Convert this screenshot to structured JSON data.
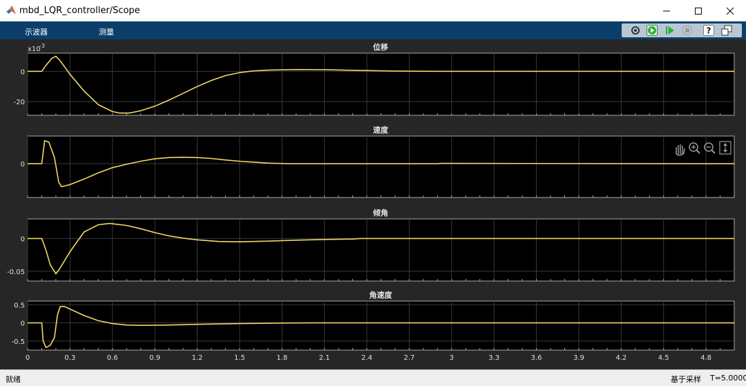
{
  "window": {
    "title": "mbd_LQR_controller/Scope",
    "minimize_icon": "minimize-icon",
    "maximize_icon": "maximize-icon",
    "close_icon": "close-icon"
  },
  "toolbar": {
    "tabs": [
      "示波器",
      "测量"
    ],
    "buttons": [
      "settings-icon",
      "run-icon",
      "step-forward-icon",
      "stop-icon",
      "help-icon",
      "undock-icon"
    ],
    "colors": {
      "background": "#0b3e6b",
      "run": "#29b23a"
    }
  },
  "plots": [
    {
      "title": "位移",
      "exponent_base": "x10",
      "exponent_power": "-3",
      "ylim": [
        -0.029,
        0.012
      ],
      "yticks": [
        {
          "value": 0,
          "label": "0"
        },
        {
          "value": -0.02,
          "label": "-20"
        }
      ],
      "points": [
        [
          0,
          0
        ],
        [
          0.1,
          0
        ],
        [
          0.13,
          0.004
        ],
        [
          0.17,
          0.0085
        ],
        [
          0.2,
          0.01
        ],
        [
          0.23,
          0.007
        ],
        [
          0.3,
          -0.002
        ],
        [
          0.4,
          -0.013
        ],
        [
          0.5,
          -0.022
        ],
        [
          0.6,
          -0.0265
        ],
        [
          0.65,
          -0.0275
        ],
        [
          0.72,
          -0.0275
        ],
        [
          0.8,
          -0.026
        ],
        [
          0.9,
          -0.023
        ],
        [
          1.0,
          -0.019
        ],
        [
          1.1,
          -0.0145
        ],
        [
          1.2,
          -0.01
        ],
        [
          1.3,
          -0.006
        ],
        [
          1.4,
          -0.0028
        ],
        [
          1.5,
          -0.0008
        ],
        [
          1.6,
          0.0003
        ],
        [
          1.7,
          0.0008
        ],
        [
          1.9,
          0.0012
        ],
        [
          2.1,
          0.0011
        ],
        [
          2.3,
          0.0007
        ],
        [
          2.6,
          0.0002
        ],
        [
          2.9,
          0
        ],
        [
          5,
          0
        ]
      ]
    },
    {
      "title": "速度",
      "ylim": [
        -0.11,
        0.09
      ],
      "yticks": [
        {
          "value": 0,
          "label": "0"
        }
      ],
      "points": [
        [
          0,
          0
        ],
        [
          0.1,
          0
        ],
        [
          0.12,
          0.075
        ],
        [
          0.15,
          0.07
        ],
        [
          0.19,
          0.02
        ],
        [
          0.22,
          -0.06
        ],
        [
          0.24,
          -0.075
        ],
        [
          0.3,
          -0.068
        ],
        [
          0.4,
          -0.05
        ],
        [
          0.5,
          -0.03
        ],
        [
          0.6,
          -0.013
        ],
        [
          0.7,
          -0.002
        ],
        [
          0.8,
          0.008
        ],
        [
          0.9,
          0.016
        ],
        [
          1.0,
          0.02
        ],
        [
          1.1,
          0.021
        ],
        [
          1.2,
          0.02
        ],
        [
          1.3,
          0.017
        ],
        [
          1.4,
          0.012
        ],
        [
          1.5,
          0.008
        ],
        [
          1.6,
          0.005
        ],
        [
          1.7,
          0.002
        ],
        [
          1.85,
          0
        ],
        [
          2.9,
          0
        ],
        [
          2.92,
          0.001
        ],
        [
          5,
          0
        ]
      ]
    },
    {
      "title": "倾角",
      "ylim": [
        -0.065,
        0.03
      ],
      "yticks": [
        {
          "value": 0,
          "label": "0"
        },
        {
          "value": -0.05,
          "label": "-0.05"
        }
      ],
      "points": [
        [
          0,
          0
        ],
        [
          0.1,
          0
        ],
        [
          0.13,
          -0.018
        ],
        [
          0.16,
          -0.04
        ],
        [
          0.2,
          -0.054
        ],
        [
          0.23,
          -0.045
        ],
        [
          0.3,
          -0.02
        ],
        [
          0.4,
          0.01
        ],
        [
          0.5,
          0.021
        ],
        [
          0.58,
          0.023
        ],
        [
          0.7,
          0.02
        ],
        [
          0.8,
          0.015
        ],
        [
          0.9,
          0.009
        ],
        [
          1.0,
          0.004
        ],
        [
          1.1,
          0.0005
        ],
        [
          1.2,
          -0.002
        ],
        [
          1.35,
          -0.0045
        ],
        [
          1.5,
          -0.005
        ],
        [
          1.7,
          -0.004
        ],
        [
          1.9,
          -0.0025
        ],
        [
          2.1,
          -0.0015
        ],
        [
          2.3,
          -0.0008
        ],
        [
          2.35,
          0
        ],
        [
          5,
          0
        ]
      ]
    },
    {
      "title": "角速度",
      "ylim": [
        -0.75,
        0.6
      ],
      "yticks": [
        {
          "value": 0.5,
          "label": "0.5"
        },
        {
          "value": 0,
          "label": "0"
        },
        {
          "value": -0.5,
          "label": "-0.5"
        }
      ],
      "points": [
        [
          0,
          0
        ],
        [
          0.1,
          0
        ],
        [
          0.11,
          -0.5
        ],
        [
          0.13,
          -0.68
        ],
        [
          0.16,
          -0.62
        ],
        [
          0.19,
          -0.4
        ],
        [
          0.21,
          0.2
        ],
        [
          0.23,
          0.45
        ],
        [
          0.26,
          0.45
        ],
        [
          0.3,
          0.38
        ],
        [
          0.4,
          0.2
        ],
        [
          0.5,
          0.06
        ],
        [
          0.6,
          -0.02
        ],
        [
          0.7,
          -0.06
        ],
        [
          0.8,
          -0.07
        ],
        [
          1.0,
          -0.06
        ],
        [
          1.2,
          -0.04
        ],
        [
          1.5,
          -0.02
        ],
        [
          1.8,
          -0.005
        ],
        [
          2.0,
          0
        ],
        [
          5,
          0
        ]
      ]
    }
  ],
  "x_axis": {
    "range": [
      0,
      5
    ],
    "ticks": [
      "0",
      "0.3",
      "0.6",
      "0.9",
      "1.2",
      "1.5",
      "1.8",
      "2.1",
      "2.4",
      "2.7",
      "3",
      "3.3",
      "3.6",
      "3.9",
      "4.2",
      "4.5",
      "4.8"
    ]
  },
  "plot_tools": [
    "pan-icon",
    "zoom-in-icon",
    "zoom-out-icon",
    "autoscale-icon"
  ],
  "trace_color": "#f1d868",
  "status": {
    "left": "就绪",
    "mode": "基于采样",
    "time": "T=5.0000"
  }
}
